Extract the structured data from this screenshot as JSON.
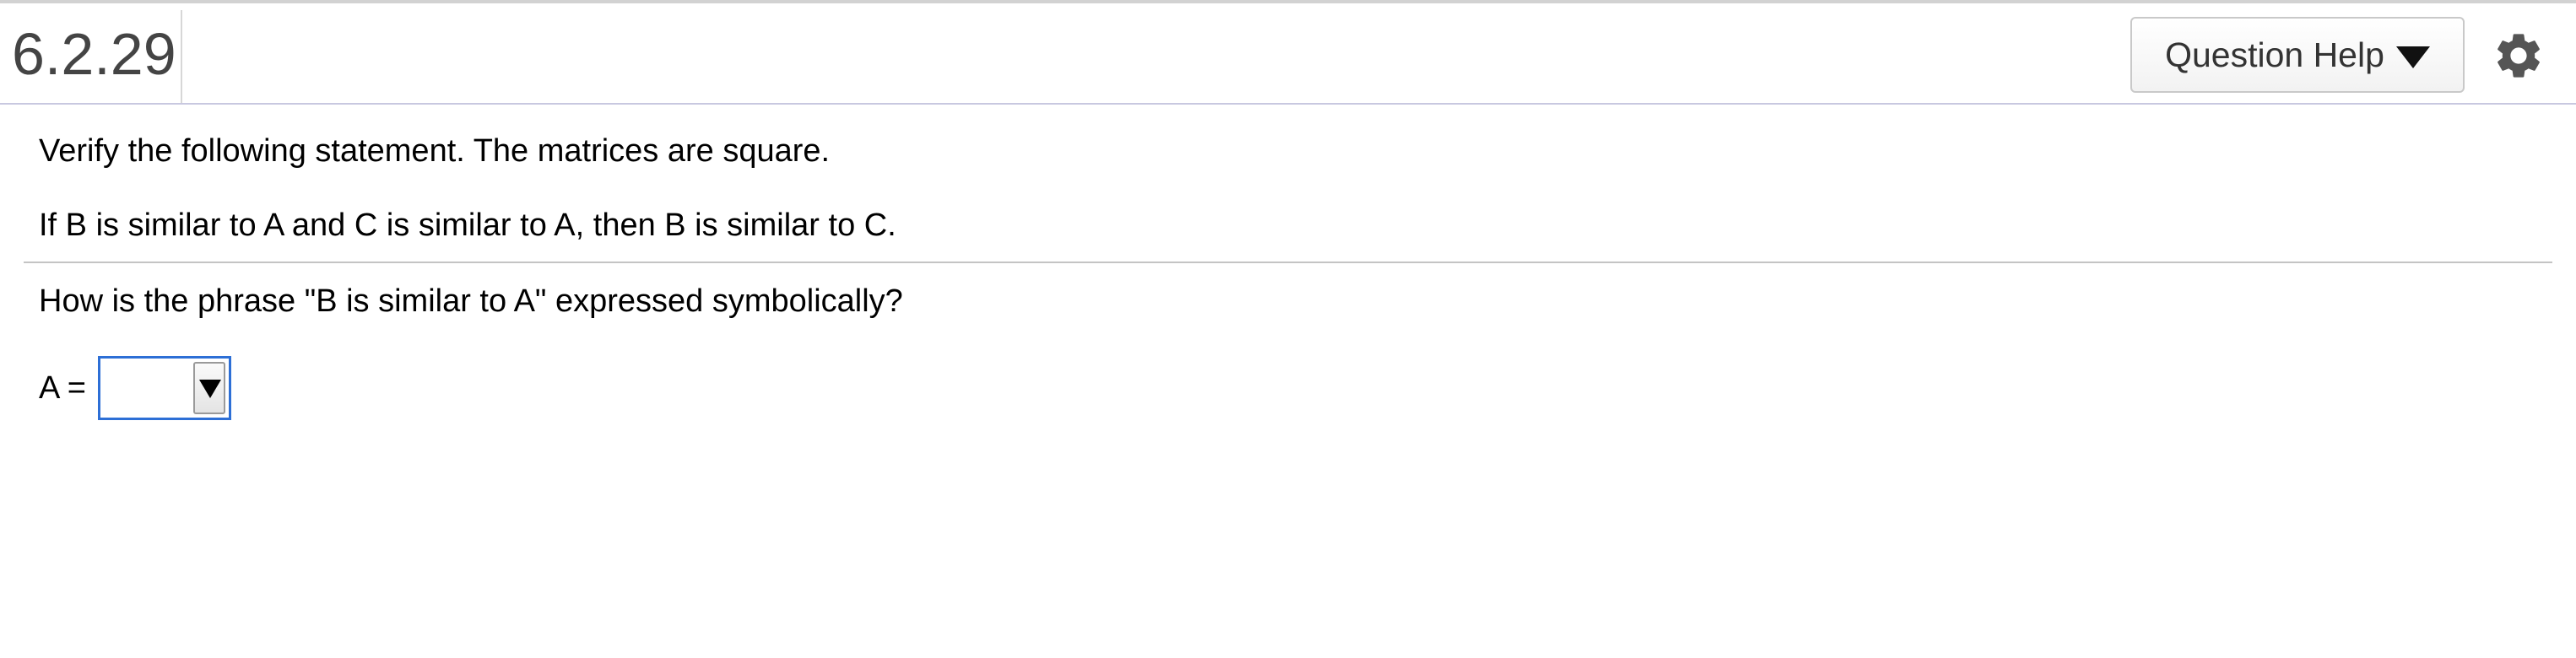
{
  "header": {
    "question_number": "6.2.29",
    "help_button_label": "Question Help",
    "help_button_icon": "caret-down-icon",
    "settings_icon": "gear-icon"
  },
  "question": {
    "instruction": "Verify the following statement. The matrices are square.",
    "statement": "If B is similar to A and C is similar to A, then B is similar to C.",
    "prompt": "How is the phrase \"B is similar to A\" expressed symbolically?",
    "answer_label": "A =",
    "answer_selected_value": ""
  },
  "colors": {
    "select_focus_border": "#2d6fd6",
    "header_text": "#444444",
    "header_divider": "#c8c8e0"
  }
}
